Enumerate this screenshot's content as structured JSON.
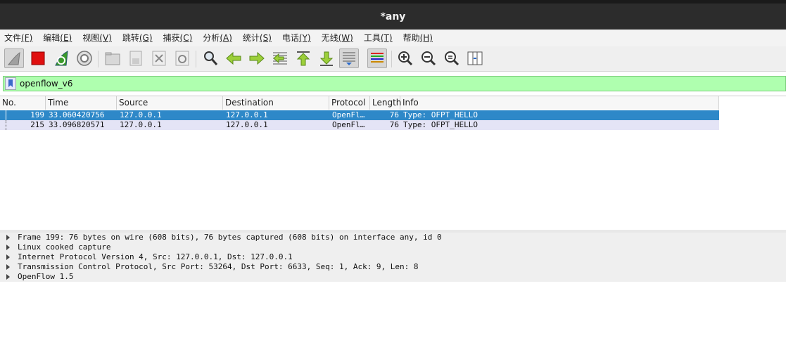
{
  "window": {
    "title": "*any"
  },
  "menu": [
    {
      "label": "文件",
      "accel": "(F)"
    },
    {
      "label": "编辑",
      "accel": "(E)"
    },
    {
      "label": "视图",
      "accel": "(V)"
    },
    {
      "label": "跳转",
      "accel": "(G)"
    },
    {
      "label": "捕获",
      "accel": "(C)"
    },
    {
      "label": "分析",
      "accel": "(A)"
    },
    {
      "label": "统计",
      "accel": "(S)"
    },
    {
      "label": "电话",
      "accel": "(Y)"
    },
    {
      "label": "无线",
      "accel": "(W)"
    },
    {
      "label": "工具",
      "accel": "(T)"
    },
    {
      "label": "帮助",
      "accel": "(H)"
    }
  ],
  "toolbar": {
    "icons": [
      "shark-fin-start-icon",
      "stop-capture-icon",
      "restart-capture-icon",
      "capture-options-icon",
      "open-file-icon",
      "save-file-icon",
      "close-file-icon",
      "reload-file-icon",
      "find-packet-icon",
      "go-back-icon",
      "go-forward-icon",
      "go-to-packet-icon",
      "first-packet-icon",
      "last-packet-icon",
      "auto-scroll-icon",
      "colorize-icon",
      "zoom-in-icon",
      "zoom-out-icon",
      "normal-size-icon",
      "resize-columns-icon"
    ]
  },
  "filter": {
    "value": "openflow_v6"
  },
  "packet_list": {
    "columns": [
      "No.",
      "Time",
      "Source",
      "Destination",
      "Protocol",
      "Length",
      "Info"
    ],
    "rows": [
      {
        "no": "199",
        "time": "33.060420756",
        "source": "127.0.0.1",
        "destination": "127.0.0.1",
        "protocol": "OpenFl…",
        "length": "76",
        "info": "Type: OFPT_HELLO",
        "selected": true
      },
      {
        "no": "215",
        "time": "33.096820571",
        "source": "127.0.0.1",
        "destination": "127.0.0.1",
        "protocol": "OpenFl…",
        "length": "76",
        "info": "Type: OFPT_HELLO",
        "selected": false
      }
    ]
  },
  "details": {
    "items": [
      "Frame 199: 76 bytes on wire (608 bits), 76 bytes captured (608 bits) on interface any, id 0",
      "Linux cooked capture",
      "Internet Protocol Version 4, Src: 127.0.0.1, Dst: 127.0.0.1",
      "Transmission Control Protocol, Src Port: 53264, Dst Port: 6633, Seq: 1, Ack: 9, Len: 8",
      "OpenFlow 1.5"
    ]
  },
  "colors": {
    "selected_row": "#2e88c8",
    "filter_ok": "#afffaf",
    "row_bg": "#e4e4f6"
  }
}
